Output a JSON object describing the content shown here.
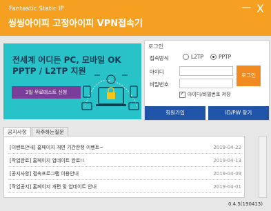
{
  "header": {
    "brand": "Fantastic Static IP",
    "title": "씽씽아이피 고정아이피 VPN접속기",
    "minimize": "—",
    "close": "X"
  },
  "banner": {
    "line1": "전세계 어디든 PC, 모바일 OK",
    "line2": "PPTP / L2TP 지원",
    "trial_button": "3일 무료테스트 신청"
  },
  "login": {
    "title": "로그인",
    "method_label": "접속방식",
    "options": [
      "L2TP",
      "PPTP"
    ],
    "selected": "PPTP",
    "id_label": "아이디",
    "id_value": "",
    "pw_label": "비밀번호",
    "pw_value": "",
    "login_button": "로그인",
    "save_label": "아이디/비밀번호 저장",
    "signup_button": "회원가입",
    "find_button": "ID/PW 찾기"
  },
  "tabs": [
    "공지사항",
    "자주하는질문"
  ],
  "active_tab": "공지사항",
  "notices": [
    {
      "title": "[이벤트안내] 홈페이지 개편 기간한정 이벤트~",
      "date": "2019-04-22"
    },
    {
      "title": "[작업완료] 홈페이지 업데이트 완료!!",
      "date": "2019-04-13"
    },
    {
      "title": "[공지사항] 접속프로그램 이용안내",
      "date": "2019-04-09"
    },
    {
      "title": "[작업공지] 홈페이지 개편 및 업데이트 안내",
      "date": "2019-04-01"
    }
  ],
  "version": "0.4.5(190413)",
  "colors": {
    "accent": "#f5a020",
    "banner": "#28c2c9",
    "navy": "#1f54a8",
    "purple": "#7a3d99",
    "login_btn": "#f08a21"
  }
}
